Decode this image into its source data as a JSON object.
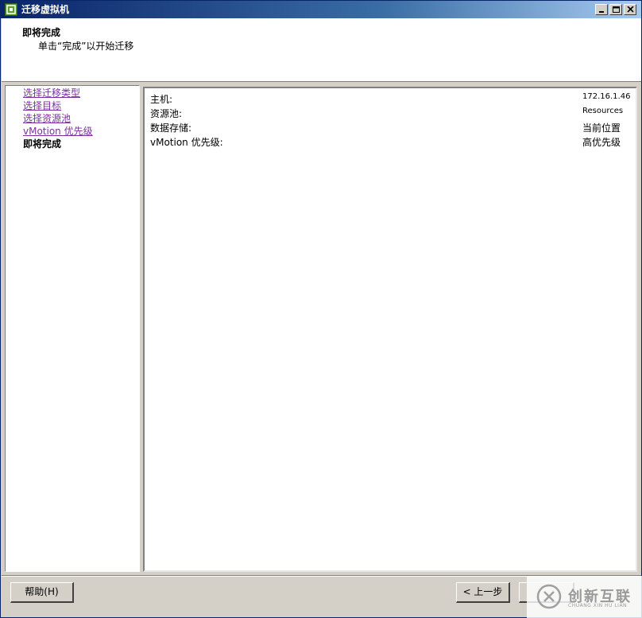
{
  "window": {
    "title": "迁移虚拟机"
  },
  "header": {
    "title": "即将完成",
    "subtitle": "单击“完成”以开始迁移"
  },
  "nav": {
    "items": [
      {
        "label": "选择迁移类型"
      },
      {
        "label": "选择目标"
      },
      {
        "label": "选择资源池"
      },
      {
        "label": "vMotion 优先级"
      },
      {
        "label": "即将完成"
      }
    ]
  },
  "summary": {
    "rows": [
      {
        "label": "主机:",
        "value": "172.16.1.46"
      },
      {
        "label": "资源池:",
        "value": "Resources"
      },
      {
        "label": "数据存储:",
        "value": "当前位置"
      },
      {
        "label": "vMotion 优先级:",
        "value": "高优先级"
      }
    ]
  },
  "buttons": {
    "help": "帮助(H)",
    "back": "< 上一步"
  },
  "watermark": {
    "main": "创新互联",
    "sub": "CHUANG XIN HU LIAN"
  }
}
